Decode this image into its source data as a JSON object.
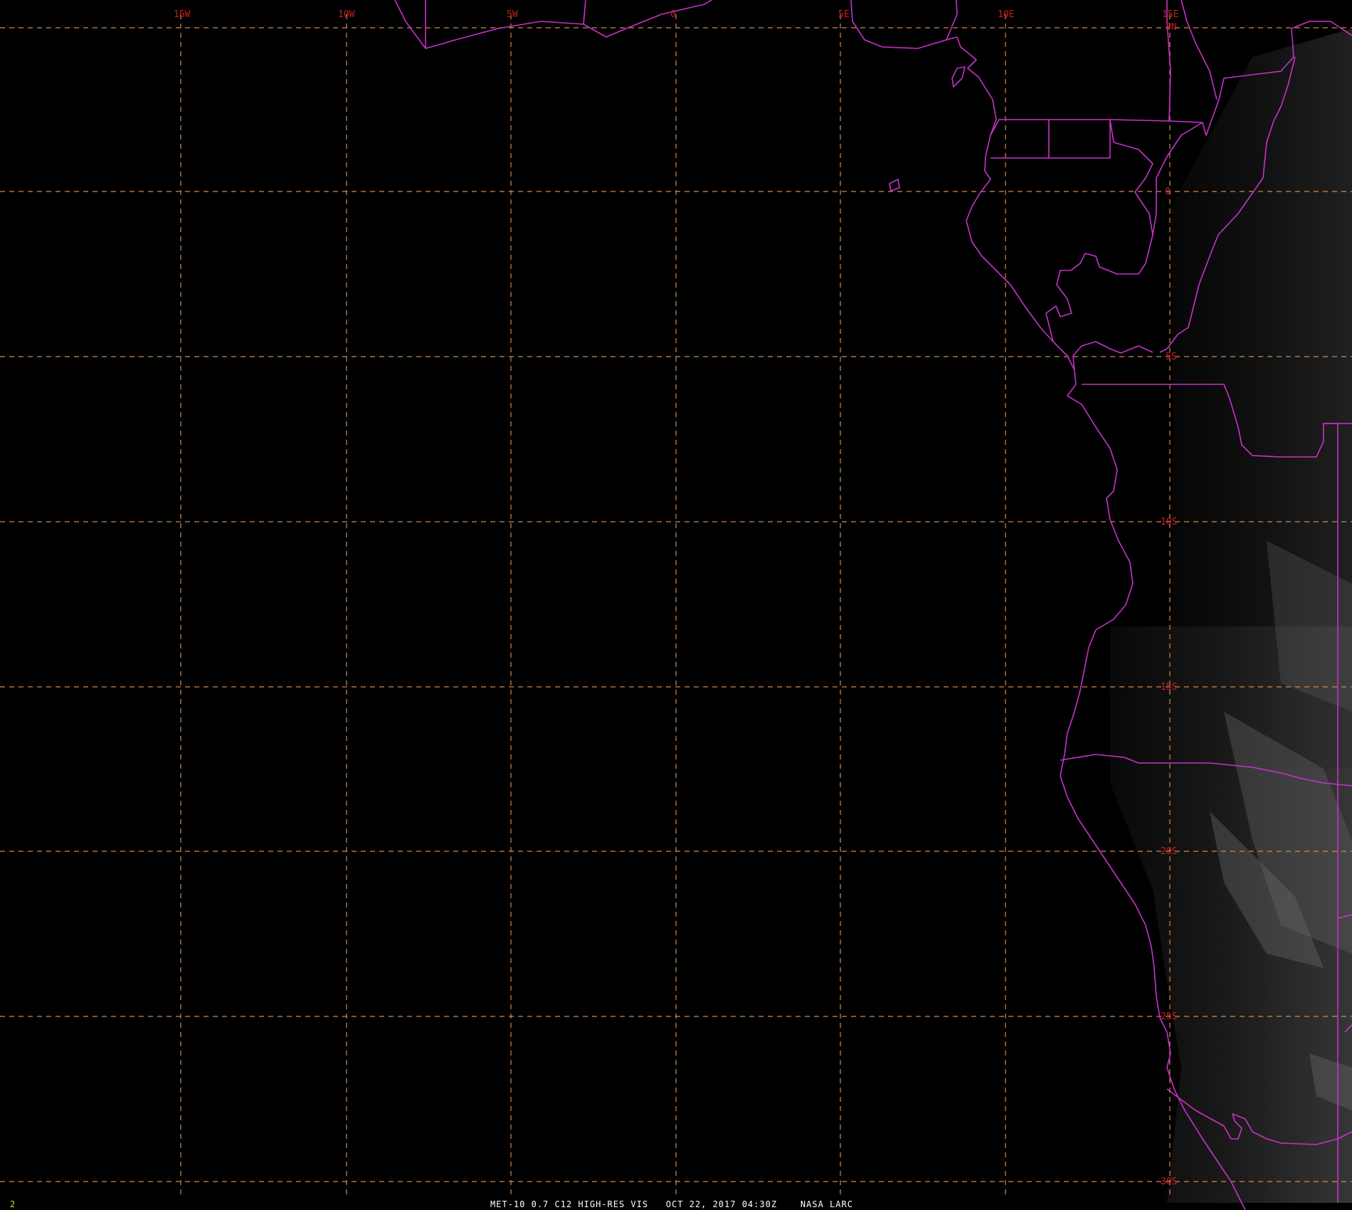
{
  "frame_number": "2",
  "caption": "MET-10 0.7 C12 HIGH-RES VIS   OCT 22, 2017 04:30Z    NASA LARC",
  "colors": {
    "background": "#000000",
    "graticule": "#d08a52",
    "coastline": "#c832c8",
    "grid_label": "#c81e1e",
    "caption_text": "#ffffff",
    "frame_number": "#e6d21e"
  },
  "longitude_labels": [
    "15W",
    "10W",
    "5W",
    "0",
    "5E",
    "10E",
    "15E"
  ],
  "latitude_labels": [
    "5N",
    "0",
    "5S",
    "10S",
    "15S",
    "20S",
    "25S",
    "30S"
  ]
}
